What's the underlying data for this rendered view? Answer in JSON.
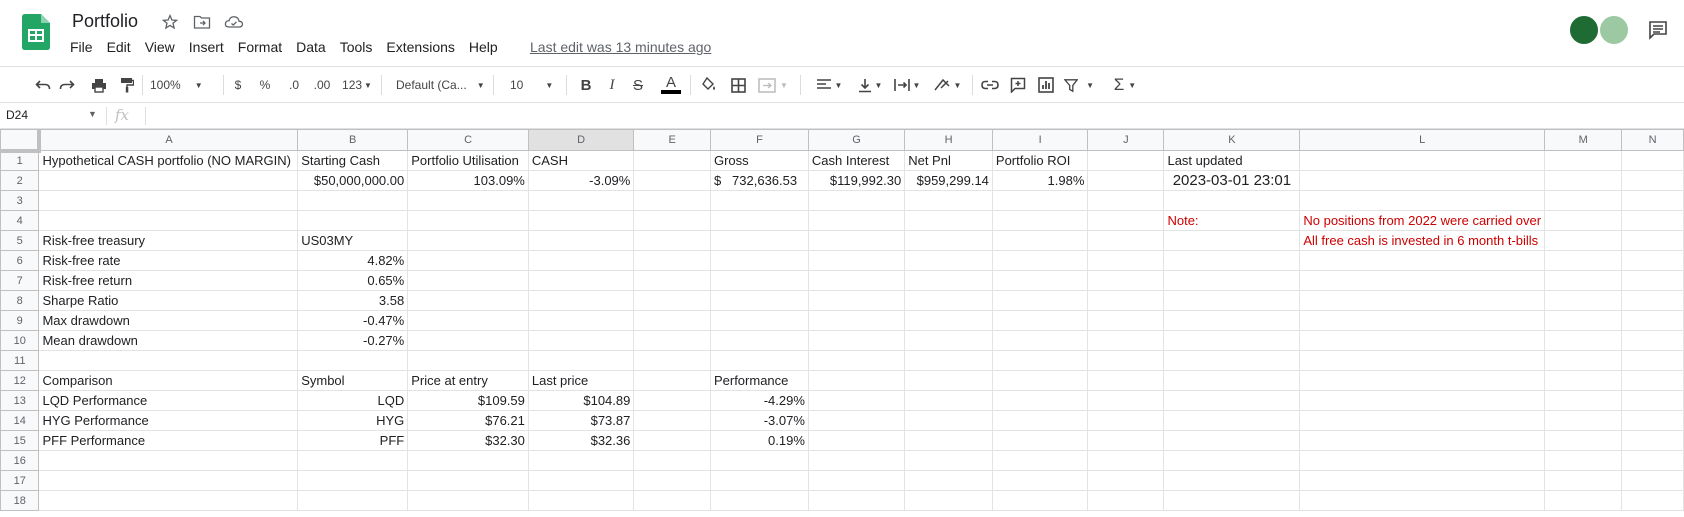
{
  "app": {
    "doc_title": "Portfolio",
    "menu": [
      "File",
      "Edit",
      "View",
      "Insert",
      "Format",
      "Data",
      "Tools",
      "Extensions",
      "Help"
    ],
    "last_edit": "Last edit was 13 minutes ago"
  },
  "toolbar": {
    "zoom": "100%",
    "currency": "$",
    "percent": "%",
    "dec_decrease": ".0",
    "dec_increase": ".00",
    "more_formats": "123",
    "font": "Default (Ca...",
    "font_size": "10"
  },
  "formula_bar": {
    "cell_ref": "D24",
    "fx": "fx",
    "value": ""
  },
  "columns": [
    "A",
    "B",
    "C",
    "D",
    "E",
    "F",
    "G",
    "H",
    "I",
    "J",
    "K",
    "L",
    "M",
    "N"
  ],
  "selected_column": "D",
  "rows": [
    {
      "n": "1",
      "cells": [
        "Hypothetical CASH portfolio (NO MARGIN)",
        "Starting Cash",
        "Portfolio Utilisation",
        "CASH",
        "",
        "Gross",
        "Cash Interest",
        "Net Pnl",
        "Portfolio ROI",
        "",
        "Last updated",
        "",
        "",
        ""
      ]
    },
    {
      "n": "2",
      "cells": [
        "",
        "$50,000,000.00",
        "103.09%",
        "-3.09%",
        "",
        "$   732,636.53",
        "$119,992.30",
        "$959,299.14",
        "1.98%",
        "",
        "2023-03-01 23:01",
        "",
        "",
        ""
      ]
    },
    {
      "n": "3",
      "cells": [
        "",
        "",
        "",
        "",
        "",
        "",
        "",
        "",
        "",
        "",
        "",
        "",
        "",
        ""
      ]
    },
    {
      "n": "4",
      "cells": [
        "",
        "",
        "",
        "",
        "",
        "",
        "",
        "",
        "",
        "",
        "Note:",
        "No positions from 2022 were carried over",
        "",
        ""
      ]
    },
    {
      "n": "5",
      "cells": [
        "Risk-free treasury",
        "US03MY",
        "",
        "",
        "",
        "",
        "",
        "",
        "",
        "",
        "",
        "All free cash is invested in 6 month t-bills",
        "",
        ""
      ]
    },
    {
      "n": "6",
      "cells": [
        "Risk-free rate",
        "4.82%",
        "",
        "",
        "",
        "",
        "",
        "",
        "",
        "",
        "",
        "",
        "",
        ""
      ]
    },
    {
      "n": "7",
      "cells": [
        "Risk-free return",
        "0.65%",
        "",
        "",
        "",
        "",
        "",
        "",
        "",
        "",
        "",
        "",
        "",
        ""
      ]
    },
    {
      "n": "8",
      "cells": [
        "Sharpe Ratio",
        "3.58",
        "",
        "",
        "",
        "",
        "",
        "",
        "",
        "",
        "",
        "",
        "",
        ""
      ]
    },
    {
      "n": "9",
      "cells": [
        "Max drawdown",
        "-0.47%",
        "",
        "",
        "",
        "",
        "",
        "",
        "",
        "",
        "",
        "",
        "",
        ""
      ]
    },
    {
      "n": "10",
      "cells": [
        "Mean drawdown",
        "-0.27%",
        "",
        "",
        "",
        "",
        "",
        "",
        "",
        "",
        "",
        "",
        "",
        ""
      ]
    },
    {
      "n": "11",
      "cells": [
        "",
        "",
        "",
        "",
        "",
        "",
        "",
        "",
        "",
        "",
        "",
        "",
        "",
        ""
      ]
    },
    {
      "n": "12",
      "cells": [
        "Comparison",
        "Symbol",
        "Price at entry",
        "Last price",
        "",
        "Performance",
        "",
        "",
        "",
        "",
        "",
        "",
        "",
        ""
      ]
    },
    {
      "n": "13",
      "cells": [
        "LQD Performance",
        "LQD",
        "$109.59",
        "$104.89",
        "",
        "-4.29%",
        "",
        "",
        "",
        "",
        "",
        "",
        "",
        ""
      ]
    },
    {
      "n": "14",
      "cells": [
        "HYG Performance",
        "HYG",
        "$76.21",
        "$73.87",
        "",
        "-3.07%",
        "",
        "",
        "",
        "",
        "",
        "",
        "",
        ""
      ]
    },
    {
      "n": "15",
      "cells": [
        "PFF Performance",
        "PFF",
        "$32.30",
        "$32.36",
        "",
        "0.19%",
        "",
        "",
        "",
        "",
        "",
        "",
        "",
        ""
      ]
    },
    {
      "n": "16",
      "cells": [
        "",
        "",
        "",
        "",
        "",
        "",
        "",
        "",
        "",
        "",
        "",
        "",
        "",
        ""
      ]
    },
    {
      "n": "17",
      "cells": [
        "",
        "",
        "",
        "",
        "",
        "",
        "",
        "",
        "",
        "",
        "",
        "",
        "",
        ""
      ]
    },
    {
      "n": "18",
      "cells": [
        "",
        "",
        "",
        "",
        "",
        "",
        "",
        "",
        "",
        "",
        "",
        "",
        "",
        ""
      ]
    }
  ],
  "colors": {
    "note_red": "#cc0000",
    "sheets_green": "#0f9d58"
  }
}
